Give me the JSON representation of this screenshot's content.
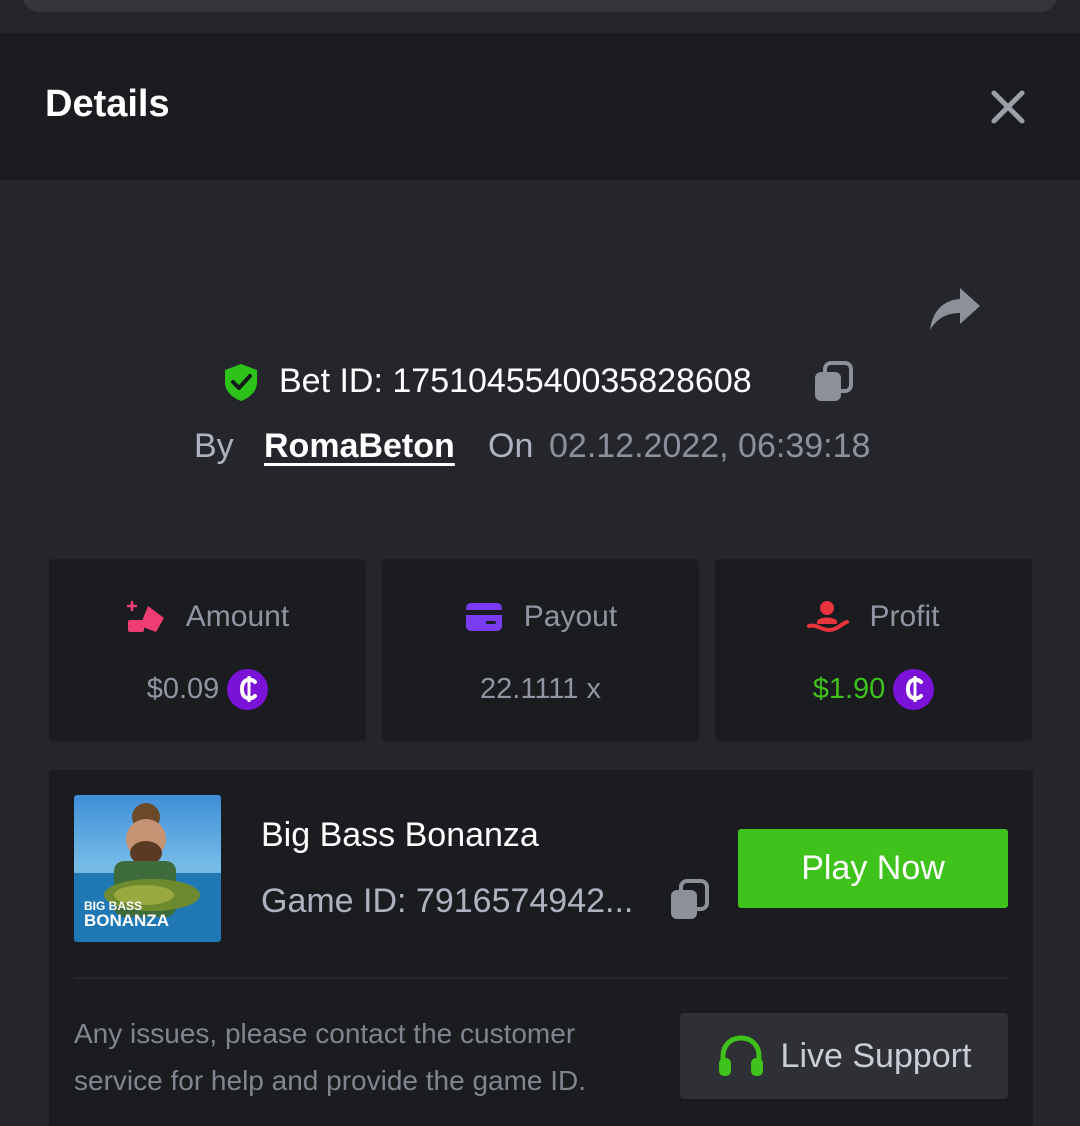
{
  "header": {
    "title": "Details"
  },
  "bet": {
    "id_label": "Bet ID: 1751045540035828608",
    "by_label": "By",
    "username": "RomaBeton",
    "on_label": "On",
    "datetime": "02.12.2022, 06:39:18"
  },
  "stats": [
    {
      "label": "Amount",
      "value": "$0.09",
      "icon": "amount-icon",
      "coin": true
    },
    {
      "label": "Payout",
      "value": "22.1111 x",
      "icon": "card-icon",
      "coin": false
    },
    {
      "label": "Profit",
      "value": "$1.90",
      "icon": "profit-icon",
      "coin": true
    }
  ],
  "game": {
    "name": "Big Bass Bonanza",
    "id_label": "Game ID: 7916574942...",
    "thumb_text_line1": "BIG BASS",
    "thumb_text_line2": "BONANZA",
    "play_label": "Play Now",
    "help_text": "Any issues, please contact the customer service for help and provide the game ID.",
    "support_label": "Live Support"
  },
  "colors": {
    "background": "#24262b",
    "panel": "#1b1c20",
    "accent_green": "#3fc21c",
    "profit_green": "#3ec21a",
    "coin_purple": "#7a12d8",
    "amount_pink": "#ee3d72",
    "payout_purple": "#7a3cf2",
    "profit_red": "#e8343c"
  }
}
